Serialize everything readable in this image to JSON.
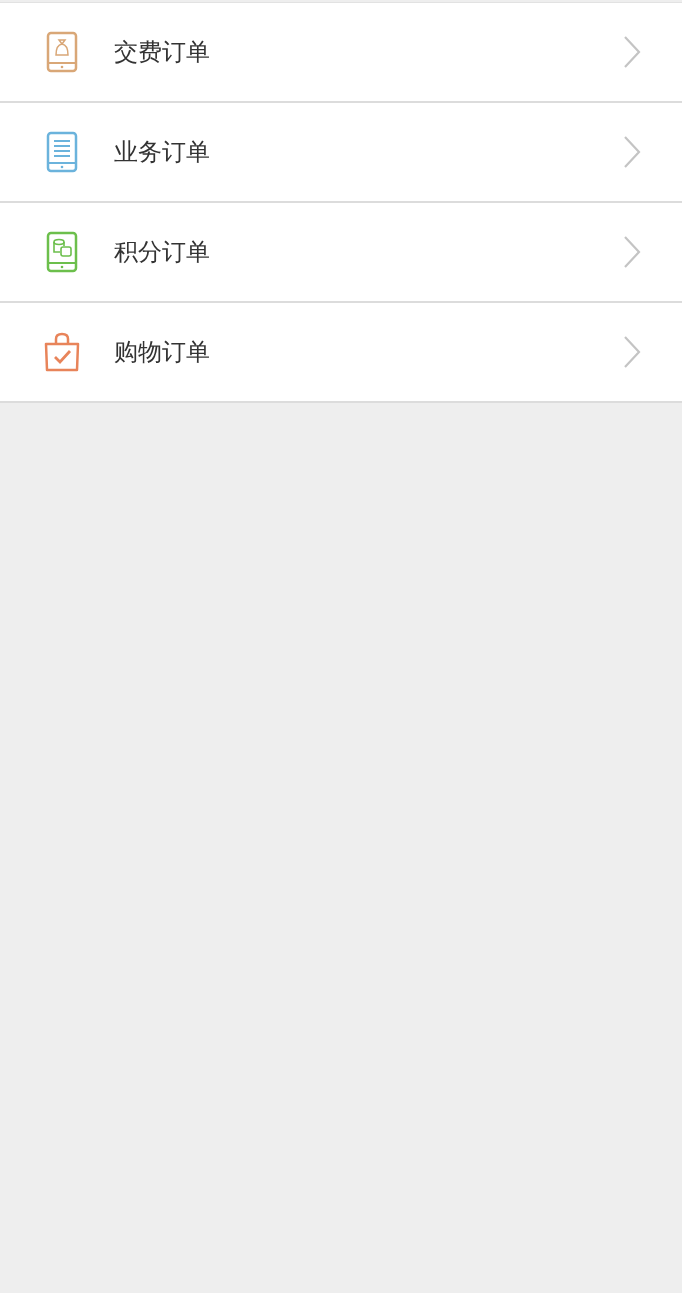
{
  "menu": [
    {
      "label": "交费订单",
      "kind": "payment",
      "color": "#d9a777"
    },
    {
      "label": "业务订单",
      "kind": "document",
      "color": "#6bb3dc"
    },
    {
      "label": "积分订单",
      "kind": "points",
      "color": "#6cbf4c"
    },
    {
      "label": "购物订单",
      "kind": "shopping",
      "color": "#e8845a"
    }
  ]
}
